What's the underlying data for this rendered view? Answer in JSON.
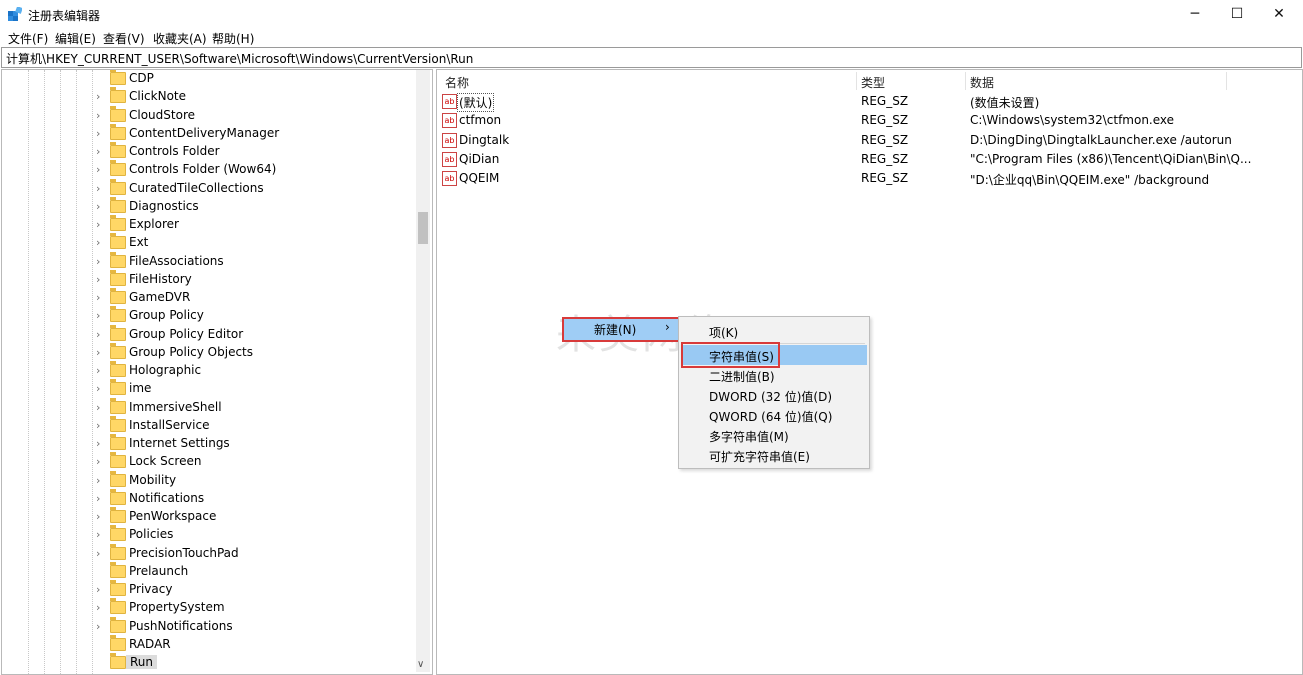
{
  "window": {
    "title": "注册表编辑器",
    "minimize_glyph": "─",
    "maximize_glyph": "☐",
    "close_glyph": "✕"
  },
  "menu": [
    "文件(F)",
    "编辑(E)",
    "查看(V)",
    "收藏夹(A)",
    "帮助(H)"
  ],
  "address": "计算机\\HKEY_CURRENT_USER\\Software\\Microsoft\\Windows\\CurrentVersion\\Run",
  "tree": [
    {
      "label": "CDP",
      "expandable": false
    },
    {
      "label": "ClickNote",
      "expandable": true
    },
    {
      "label": "CloudStore",
      "expandable": true
    },
    {
      "label": "ContentDeliveryManager",
      "expandable": true
    },
    {
      "label": "Controls Folder",
      "expandable": true
    },
    {
      "label": "Controls Folder (Wow64)",
      "expandable": true
    },
    {
      "label": "CuratedTileCollections",
      "expandable": true
    },
    {
      "label": "Diagnostics",
      "expandable": true
    },
    {
      "label": "Explorer",
      "expandable": true
    },
    {
      "label": "Ext",
      "expandable": true
    },
    {
      "label": "FileAssociations",
      "expandable": true
    },
    {
      "label": "FileHistory",
      "expandable": true
    },
    {
      "label": "GameDVR",
      "expandable": true
    },
    {
      "label": "Group Policy",
      "expandable": true
    },
    {
      "label": "Group Policy Editor",
      "expandable": true
    },
    {
      "label": "Group Policy Objects",
      "expandable": true
    },
    {
      "label": "Holographic",
      "expandable": true
    },
    {
      "label": "ime",
      "expandable": true
    },
    {
      "label": "ImmersiveShell",
      "expandable": true
    },
    {
      "label": "InstallService",
      "expandable": true
    },
    {
      "label": "Internet Settings",
      "expandable": true
    },
    {
      "label": "Lock Screen",
      "expandable": true
    },
    {
      "label": "Mobility",
      "expandable": true
    },
    {
      "label": "Notifications",
      "expandable": true
    },
    {
      "label": "PenWorkspace",
      "expandable": true
    },
    {
      "label": "Policies",
      "expandable": true
    },
    {
      "label": "PrecisionTouchPad",
      "expandable": true
    },
    {
      "label": "Prelaunch",
      "expandable": false
    },
    {
      "label": "Privacy",
      "expandable": true
    },
    {
      "label": "PropertySystem",
      "expandable": true
    },
    {
      "label": "PushNotifications",
      "expandable": true
    },
    {
      "label": "RADAR",
      "expandable": false
    },
    {
      "label": "Run",
      "expandable": false,
      "selected": true
    }
  ],
  "list": {
    "headers": {
      "name": "名称",
      "type": "类型",
      "data": "数据"
    },
    "icon_text": "ab",
    "rows": [
      {
        "name": "(默认)",
        "type": "REG_SZ",
        "data": "(数值未设置)",
        "is_default": true
      },
      {
        "name": "ctfmon",
        "type": "REG_SZ",
        "data": "C:\\Windows\\system32\\ctfmon.exe"
      },
      {
        "name": "Dingtalk",
        "type": "REG_SZ",
        "data": "D:\\DingDing\\DingtalkLauncher.exe /autorun"
      },
      {
        "name": "QiDian",
        "type": "REG_SZ",
        "data": "\"C:\\Program Files (x86)\\Tencent\\QiDian\\Bin\\Q..."
      },
      {
        "name": "QQEIM",
        "type": "REG_SZ",
        "data": "\"D:\\企业qq\\Bin\\QQEIM.exe\" /background"
      }
    ]
  },
  "context_menu": {
    "new_label": "新建(N)",
    "arrow": "›",
    "submenu": [
      "项(K)",
      "字符串值(S)",
      "二进制值(B)",
      "DWORD (32 位)值(D)",
      "QWORD (64 位)值(Q)",
      "多字符串值(M)",
      "可扩充字符串值(E)"
    ],
    "highlighted_index": 1
  },
  "watermark": "来美网络",
  "colors": {
    "highlight_blue": "#99c9f3",
    "annotation_red": "#d83a3a",
    "folder_yellow": "#ffd766"
  }
}
